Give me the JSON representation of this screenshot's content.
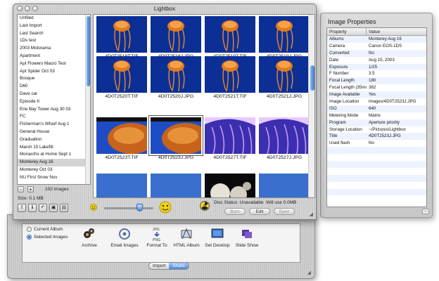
{
  "lightbox": {
    "title": "Lightbox",
    "albums": [
      "Unfiled",
      "Last Import",
      "Last Search",
      "1Ds test",
      "2003 Motorama",
      "Apartment",
      "Apt Flowers Macro Test",
      "Apt Spider Oct 03",
      "Bosque",
      "D60",
      "Dave car",
      "Episode II",
      "Erie Bay Tower Aug 30 03",
      "FC",
      "Fisherman's Wharf Aug 1",
      "General House",
      "Graduation",
      "March 15 Lakefill",
      "Monarchs at Home Sept 1",
      "Monterey Aug 16",
      "Monterey Oct 03",
      "NU First Snow Nov"
    ],
    "selected_album_index": 19,
    "album_add": "+",
    "album_remove": "-",
    "image_count": "102  images",
    "size_label": "Size:  0.1 MB",
    "tools": [
      "⇧",
      "ℹ",
      "↶",
      "▣",
      "▤"
    ],
    "thumbnails": [
      {
        "name": "4D0T2518T.TIF",
        "kind": "jelly"
      },
      {
        "name": "4D0T2518J.JPG",
        "kind": "jelly"
      },
      {
        "name": "4D0T2519T.TIF",
        "kind": "jelly"
      },
      {
        "name": "4D0T2519J.JPG",
        "kind": "jelly"
      },
      {
        "name": "4D0T2520T.TIF",
        "kind": "jelly"
      },
      {
        "name": "4D0T2520J.JPG",
        "kind": "jelly"
      },
      {
        "name": "4D0T2521T.TIF",
        "kind": "jelly"
      },
      {
        "name": "4D0T2521J.JPG",
        "kind": "jelly"
      },
      {
        "name": "4D0T2523T.TIF",
        "kind": "close"
      },
      {
        "name": "4D0T2523J.JPG",
        "kind": "close"
      },
      {
        "name": "4D0T2527T.TIF",
        "kind": "purple"
      },
      {
        "name": "4D0T2527J.JPG",
        "kind": "purple"
      },
      {
        "name": "",
        "kind": "sky"
      },
      {
        "name": "",
        "kind": "sky"
      },
      {
        "name": "",
        "kind": "moon"
      },
      {
        "name": "",
        "kind": "sky"
      }
    ],
    "selected_thumbnail_index": 9,
    "zoom_position": 0.72,
    "disc_status_label": "Disc Status:",
    "disc_status_value": "Unavailable",
    "will_use_label": "Will use",
    "will_use_value": "0.0MB",
    "burn_button": "Burn",
    "edit_button": "Edit",
    "eject_button": "Eject"
  },
  "properties": {
    "title": "Image Properties",
    "col_property": "Property",
    "col_value": "Value",
    "rows": [
      {
        "k": "Albums",
        "v": "Monterey Aug 16"
      },
      {
        "k": "Camera",
        "v": "Canon EOS-1DS"
      },
      {
        "k": "Converted",
        "v": "No"
      },
      {
        "k": "Date",
        "v": "Aug 15, 2003"
      },
      {
        "k": "Exposure",
        "v": "1/25"
      },
      {
        "k": "F Number",
        "v": "3.5"
      },
      {
        "k": "Focal Length",
        "v": "180"
      },
      {
        "k": "Focal Length (35mm)",
        "v": "362"
      },
      {
        "k": "Image Available",
        "v": "Yes"
      },
      {
        "k": "Image Location",
        "v": "images/4D0T2523J.JPG"
      },
      {
        "k": "ISO",
        "v": "640"
      },
      {
        "k": "Metering Mode",
        "v": "Matrix"
      },
      {
        "k": "Program",
        "v": "Aperture priority"
      },
      {
        "k": "Storage Location",
        "v": "~/Pictures/Lightbox"
      },
      {
        "k": "Title",
        "v": "4D0T2523J.JPG"
      },
      {
        "k": "Used flash",
        "v": "No"
      },
      {
        "k": "",
        "v": ""
      },
      {
        "k": "",
        "v": ""
      },
      {
        "k": "",
        "v": ""
      },
      {
        "k": "",
        "v": ""
      },
      {
        "k": "",
        "v": ""
      },
      {
        "k": "",
        "v": ""
      },
      {
        "k": "",
        "v": ""
      },
      {
        "k": "",
        "v": ""
      }
    ]
  },
  "share": {
    "current_album": "Current Album",
    "selected_images": "Selected Images",
    "actions": [
      "Archive",
      "Email Images",
      "Format To",
      "HTML Album",
      "Set Desktop",
      "Slide Show"
    ],
    "tab_import": "Import",
    "tab_share": "Share"
  }
}
